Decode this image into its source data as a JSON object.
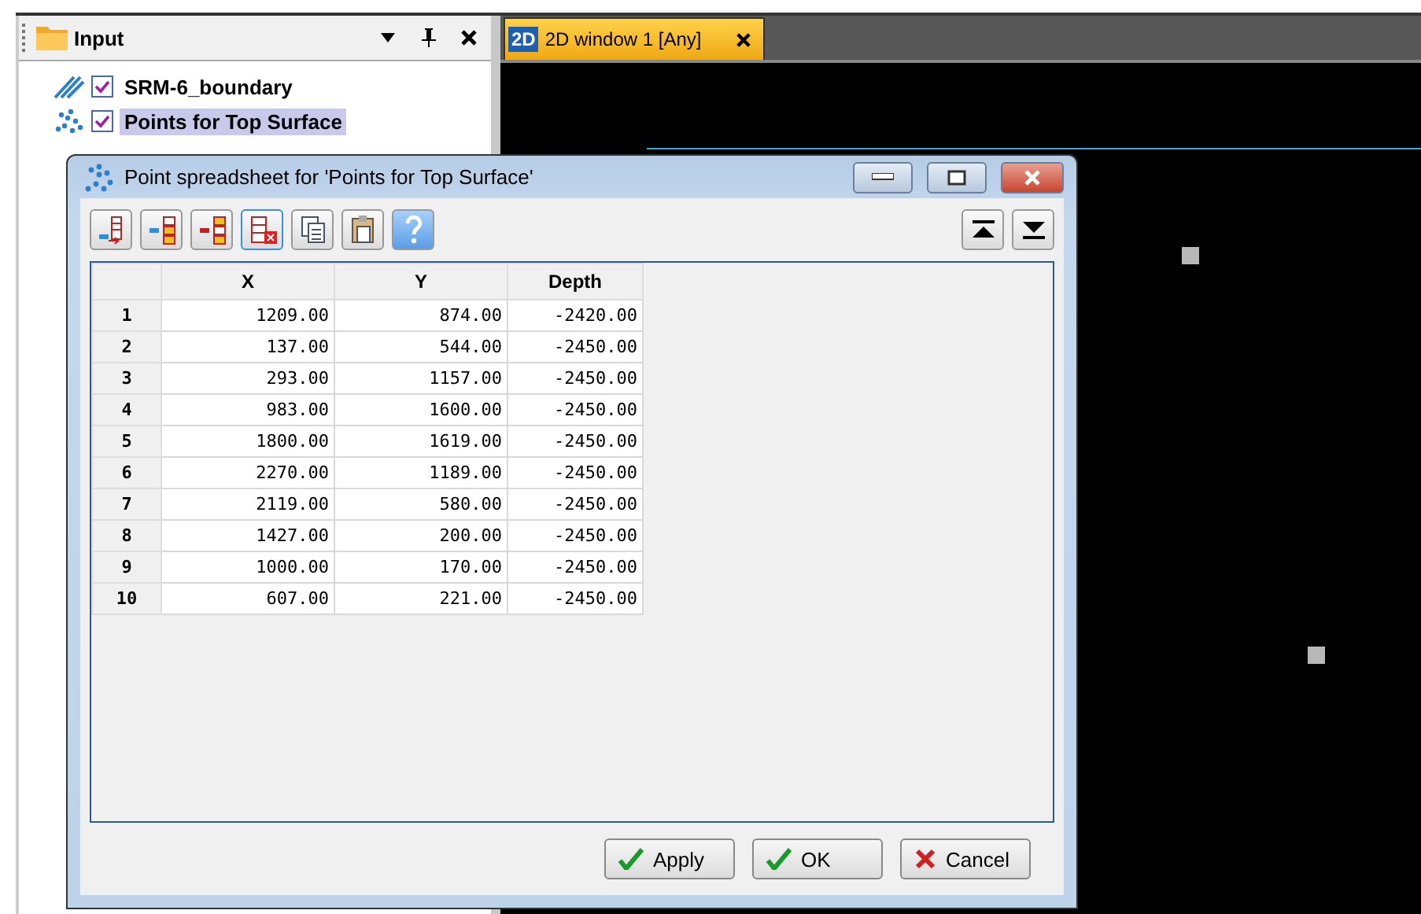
{
  "input_panel": {
    "title": "Input",
    "tree": [
      {
        "label": "SRM-6_boundary",
        "kind": "polygon",
        "checked": true,
        "selected": false
      },
      {
        "label": "Points for Top Surface",
        "kind": "points",
        "checked": true,
        "selected": true
      }
    ]
  },
  "tabs": [
    {
      "badge": "2D",
      "label": "2D window 1 [Any]",
      "selected": true
    }
  ],
  "dialog": {
    "title": "Point spreadsheet for 'Points for Top Surface'",
    "table": {
      "columns": [
        "X",
        "Y",
        "Depth"
      ],
      "rows": [
        {
          "index": "1",
          "cells": [
            "1209.00",
            "874.00",
            "-2420.00"
          ]
        },
        {
          "index": "2",
          "cells": [
            "137.00",
            "544.00",
            "-2450.00"
          ]
        },
        {
          "index": "3",
          "cells": [
            "293.00",
            "1157.00",
            "-2450.00"
          ]
        },
        {
          "index": "4",
          "cells": [
            "983.00",
            "1600.00",
            "-2450.00"
          ]
        },
        {
          "index": "5",
          "cells": [
            "1800.00",
            "1619.00",
            "-2450.00"
          ]
        },
        {
          "index": "6",
          "cells": [
            "2270.00",
            "1189.00",
            "-2450.00"
          ]
        },
        {
          "index": "7",
          "cells": [
            "2119.00",
            "580.00",
            "-2450.00"
          ]
        },
        {
          "index": "8",
          "cells": [
            "1427.00",
            "200.00",
            "-2450.00"
          ]
        },
        {
          "index": "9",
          "cells": [
            "1000.00",
            "170.00",
            "-2450.00"
          ]
        },
        {
          "index": "10",
          "cells": [
            "607.00",
            "221.00",
            "-2450.00"
          ]
        }
      ]
    },
    "buttons": [
      {
        "label": "Apply",
        "kind": "apply"
      },
      {
        "label": "OK",
        "kind": "ok"
      },
      {
        "label": "Cancel",
        "kind": "cancel"
      }
    ]
  }
}
